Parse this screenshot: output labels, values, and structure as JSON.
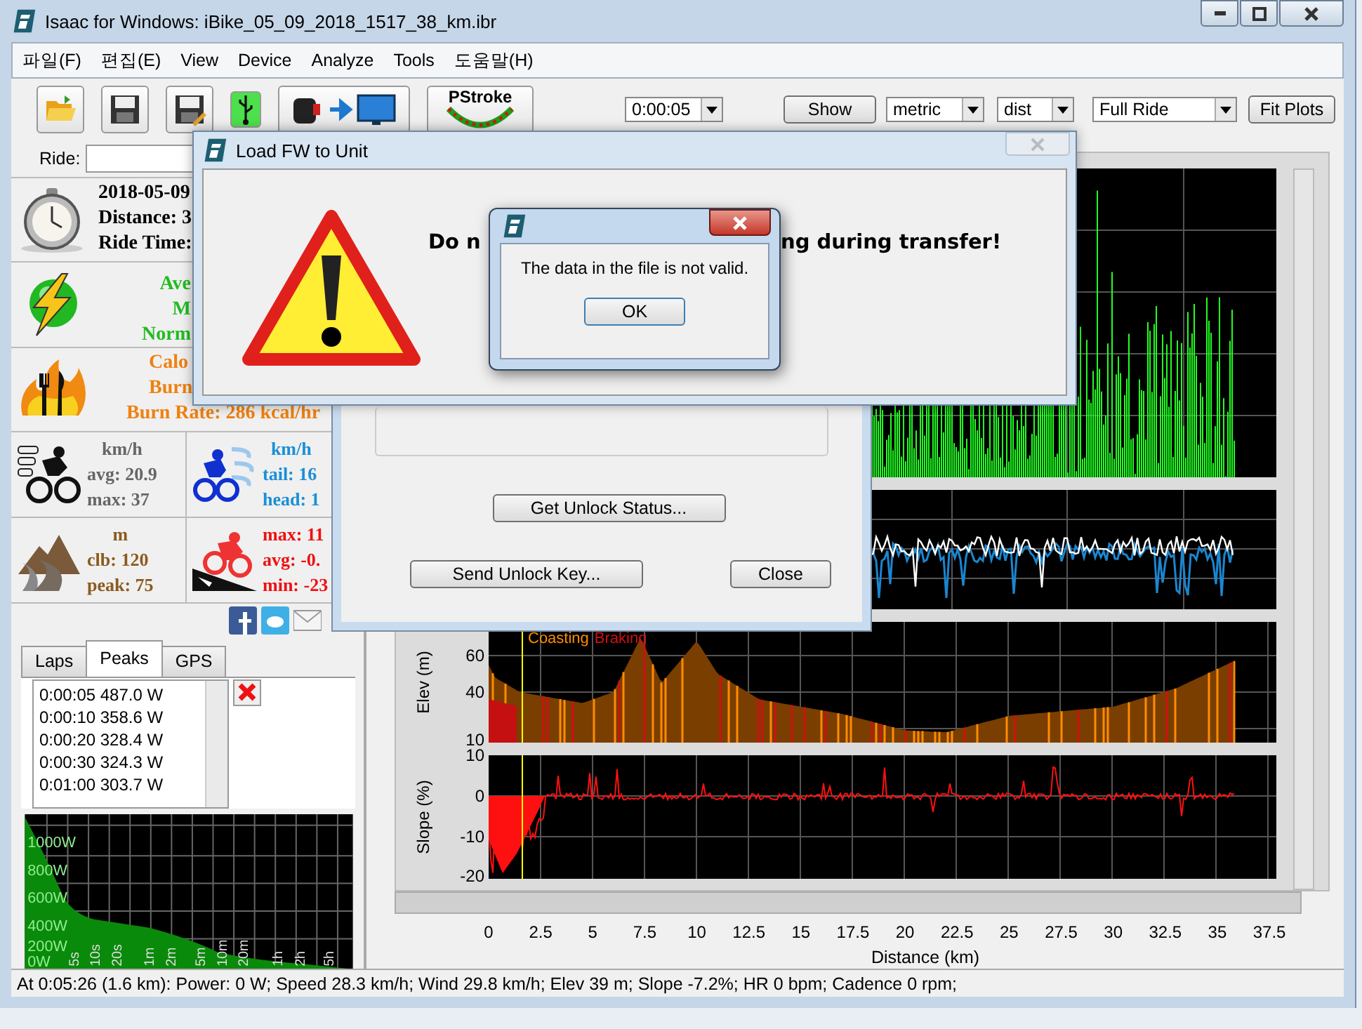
{
  "window": {
    "title": "Isaac for Windows:  iBike_05_09_2018_1517_38_km.ibr"
  },
  "menu": [
    "파일(F)",
    "편집(E)",
    "View",
    "Device",
    "Analyze",
    "Tools",
    "도움말(H)"
  ],
  "toolbar": {
    "pstroke": "PStroke",
    "interval": "0:00:05",
    "show_button": "Show",
    "units": "metric",
    "axis": "dist",
    "range": "Full Ride",
    "fit_button": "Fit Plots"
  },
  "ride": {
    "label": "Ride:"
  },
  "summary": [
    "2018-05-09",
    "Distance: 3",
    "Ride Time:"
  ],
  "power": [
    "Ave",
    "M",
    "Norm"
  ],
  "calories": [
    "Calo",
    "Burn",
    "Burn Rate: 286 kcal/hr"
  ],
  "stats": [
    {
      "kind": "speed",
      "color": "#666666",
      "lines": [
        "km/h",
        "avg: 20.9",
        "max: 37"
      ]
    },
    {
      "kind": "wind",
      "color": "#1a8fd6",
      "lines": [
        "km/h",
        "tail: 16",
        "head: 1"
      ]
    },
    {
      "kind": "climb",
      "color": "#8b5a1e",
      "lines": [
        "m",
        "clb: 120",
        "peak: 75"
      ]
    },
    {
      "kind": "slope",
      "color": "#ee1111",
      "lines": [
        "max: 11",
        "avg: -0.",
        "min: -23"
      ]
    }
  ],
  "tabs": [
    {
      "label": "Laps",
      "selected": false
    },
    {
      "label": "Peaks",
      "selected": true
    },
    {
      "label": "GPS",
      "selected": false
    }
  ],
  "peaks": [
    "0:00:05 487.0 W",
    "0:00:10 358.6 W",
    "0:00:20 328.4 W",
    "0:00:30 324.3 W",
    "0:01:00 303.7 W"
  ],
  "peak_chart": {
    "y_ticks": [
      "1000W",
      "800W",
      "600W",
      "400W",
      "200W",
      "0W"
    ],
    "x_ticks": [
      "5s",
      "10s",
      "20s",
      "1m",
      "2m",
      "5m",
      "10m",
      "20m",
      "1h",
      "2h",
      "5h"
    ]
  },
  "plots": [
    {
      "kind": "power"
    },
    {
      "kind": "wind"
    },
    {
      "kind": "elevation",
      "ylabel": "Elev (m)",
      "yticks": [
        "60",
        "40",
        "10"
      ],
      "legend": [
        "Coasting",
        "Braking"
      ]
    },
    {
      "kind": "slope",
      "ylabel": "Slope (%)",
      "yticks": [
        "10",
        "0",
        "-10",
        "-20"
      ]
    }
  ],
  "x_axis": {
    "ticks": [
      "0",
      "2.5",
      "5",
      "7.5",
      "10",
      "12.5",
      "15",
      "17.5",
      "20",
      "22.5",
      "25",
      "27.5",
      "30",
      "32.5",
      "35",
      "37.5"
    ],
    "label": "Distance (km)"
  },
  "status_bar": "At 0:05:26 (1.6 km): Power: 0 W; Speed 28.3 km/h; Wind 29.8 km/h; Elev 39 m; Slope -7.2%; HR 0 bpm; Cadence 0 rpm;",
  "unlock_window": {
    "buttons": [
      "Get Unlock Status...",
      "Send Unlock Key...",
      "Close"
    ]
  },
  "fw_dialog": {
    "title": "Load FW to Unit",
    "message_start": "Do n",
    "message_end": "ng during transfer!"
  },
  "message_box": {
    "text": "The data in the file is not valid.",
    "button": "OK"
  }
}
